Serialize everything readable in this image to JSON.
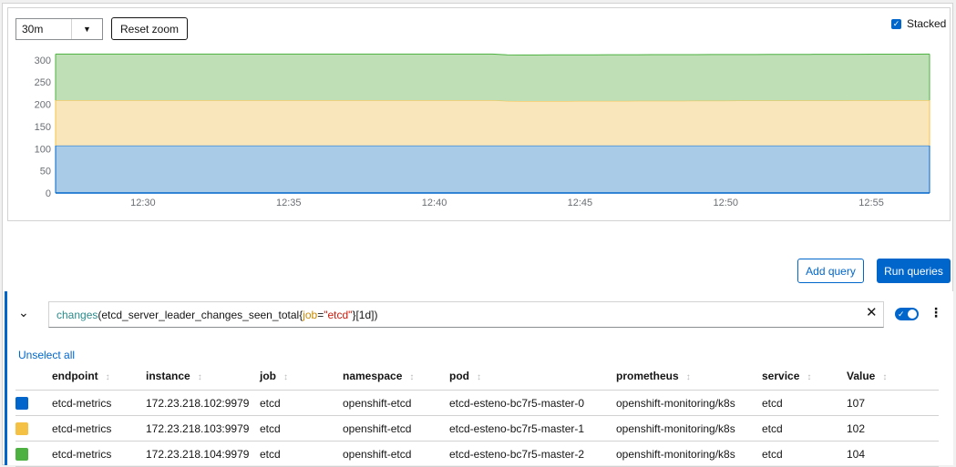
{
  "controls": {
    "time_span": "30m",
    "reset_zoom_label": "Reset zoom",
    "stacked_label": "Stacked",
    "stacked_checked": true,
    "add_query_label": "Add query",
    "run_queries_label": "Run queries"
  },
  "query": {
    "fn": "changes",
    "metric_open": "(etcd_server_leader_changes_seen_total{",
    "label_key": "job",
    "label_eq": "=",
    "label_value": "\"etcd\"",
    "range_close": "}[1d])",
    "unselect_all_label": "Unselect all"
  },
  "table": {
    "columns": [
      "endpoint",
      "instance",
      "job",
      "namespace",
      "pod",
      "prometheus",
      "service",
      "Value"
    ],
    "rows": [
      {
        "color": "#0066cc",
        "cells": [
          "etcd-metrics",
          "172.23.218.102:9979",
          "etcd",
          "openshift-etcd",
          "etcd-esteno-bc7r5-master-0",
          "openshift-monitoring/k8s",
          "etcd",
          "107"
        ]
      },
      {
        "color": "#f4c145",
        "cells": [
          "etcd-metrics",
          "172.23.218.103:9979",
          "etcd",
          "openshift-etcd",
          "etcd-esteno-bc7r5-master-1",
          "openshift-monitoring/k8s",
          "etcd",
          "102"
        ]
      },
      {
        "color": "#4cb140",
        "cells": [
          "etcd-metrics",
          "172.23.218.104:9979",
          "etcd",
          "openshift-etcd",
          "etcd-esteno-bc7r5-master-2",
          "openshift-monitoring/k8s",
          "etcd",
          "104"
        ]
      }
    ]
  },
  "chart_data": {
    "type": "area",
    "stacked": true,
    "ylim": [
      0,
      320
    ],
    "yticks": [
      0,
      50,
      100,
      150,
      200,
      250,
      300
    ],
    "xticks": [
      "12:30",
      "12:35",
      "12:40",
      "12:45",
      "12:50",
      "12:55"
    ],
    "x_range": [
      "12:27",
      "12:57"
    ],
    "series": [
      {
        "color": "#0066cc",
        "fill": "#a9cbe8",
        "points": [
          [
            0,
            107
          ],
          [
            0.9,
            107
          ],
          [
            1,
            107
          ]
        ]
      },
      {
        "color": "#f4c145",
        "fill": "#f9e6bb",
        "points": [
          [
            0,
            102
          ],
          [
            0.5,
            102
          ],
          [
            0.52,
            100
          ],
          [
            1,
            102
          ]
        ]
      },
      {
        "color": "#4cb140",
        "fill": "#bfe0b7",
        "points": [
          [
            0,
            104
          ],
          [
            0.5,
            104
          ],
          [
            0.7,
            104
          ],
          [
            1,
            104
          ]
        ]
      }
    ]
  }
}
